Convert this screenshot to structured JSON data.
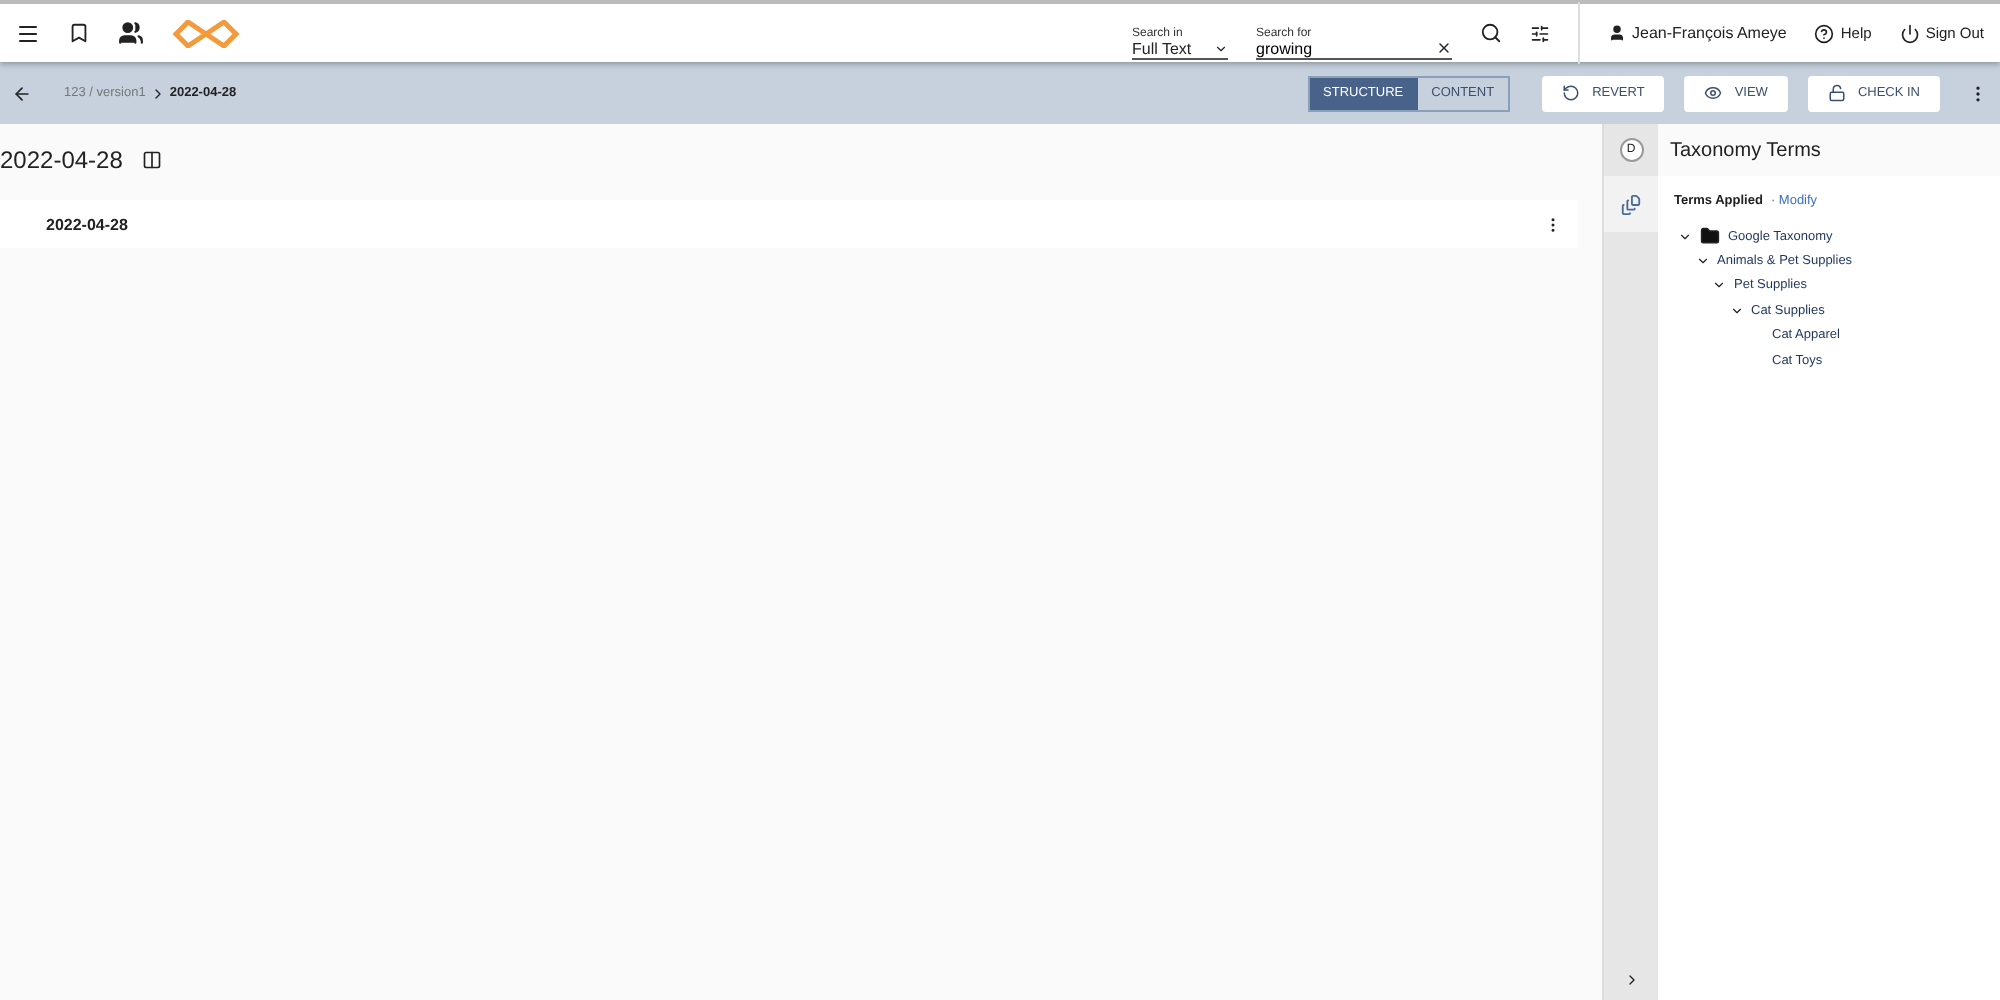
{
  "search": {
    "scope_label": "Search in",
    "scope_value": "Full Text",
    "query_label": "Search for",
    "query_value": "growing"
  },
  "user": {
    "name": "Jean-François Ameye"
  },
  "header_links": [
    "Help",
    "Sign Out"
  ],
  "breadcrumb": {
    "parent": "123 / version1",
    "current": "2022-04-28"
  },
  "view_tabs": [
    {
      "label": "STRUCTURE",
      "selected": true
    },
    {
      "label": "CONTENT",
      "selected": false
    }
  ],
  "actions": [
    "REVERT",
    "VIEW",
    "CHECK IN"
  ],
  "document": {
    "title": "2022-04-28",
    "rows": [
      "2022-04-28"
    ]
  },
  "rail": {
    "badge": "D"
  },
  "panel": {
    "title": "Taxonomy Terms",
    "terms_label": "Terms Applied",
    "modify_link": "· Modify",
    "tree": [
      {
        "label": "Google Taxonomy",
        "kind": "folder",
        "expanded": true,
        "children": [
          {
            "label": "Animals & Pet Supplies",
            "expanded": true,
            "children": [
              {
                "label": "Pet Supplies",
                "expanded": true,
                "children": [
                  {
                    "label": "Cat Supplies",
                    "expanded": true,
                    "children": [
                      {
                        "label": "Cat Apparel"
                      },
                      {
                        "label": "Cat Toys"
                      }
                    ]
                  }
                ]
              }
            ]
          }
        ]
      }
    ]
  }
}
